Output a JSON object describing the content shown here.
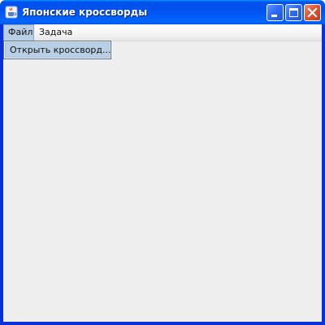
{
  "window": {
    "title": "Японские кроссворды",
    "icon": "java-cup-icon",
    "controls": [
      "minimize-icon",
      "maximize-icon",
      "close-icon"
    ]
  },
  "menubar": {
    "items": [
      {
        "label": "Файл",
        "state": "open"
      },
      {
        "label": "Задача"
      }
    ]
  },
  "dropdown": {
    "items": [
      {
        "label": "Открыть кроссворд...",
        "state": "highlighted"
      }
    ]
  },
  "colors": {
    "title_bar": "#0053ee",
    "client_background": "#eeeeee",
    "menu_highlight": "#b8cfe5",
    "close_button": "#df5634"
  }
}
